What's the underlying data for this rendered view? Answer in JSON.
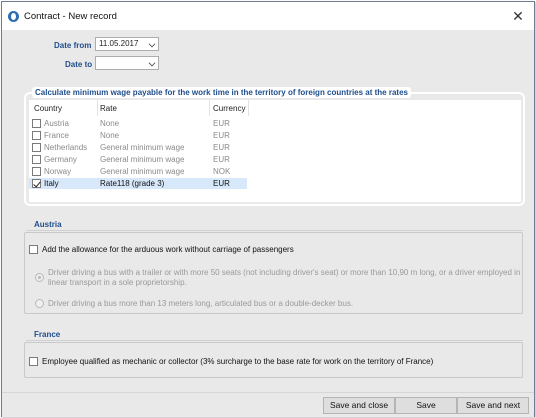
{
  "window": {
    "title": "Contract - New record"
  },
  "form": {
    "date_from_label": "Date from",
    "date_from_value": "11.05.2017",
    "date_to_label": "Date to",
    "date_to_value": ""
  },
  "rates": {
    "legend": "Calculate minimum wage payable for the work time in the territory of foreign countries at the rates",
    "columns": [
      "Country",
      "Rate",
      "Currency"
    ],
    "rows": [
      {
        "country": "Austria",
        "rate": "None",
        "currency": "EUR",
        "checked": false
      },
      {
        "country": "France",
        "rate": "None",
        "currency": "EUR",
        "checked": false
      },
      {
        "country": "Netherlands",
        "rate": "General minimum wage",
        "currency": "EUR",
        "checked": false
      },
      {
        "country": "Germany",
        "rate": "General minimum wage",
        "currency": "EUR",
        "checked": false
      },
      {
        "country": "Norway",
        "rate": "General minimum wage",
        "currency": "NOK",
        "checked": false
      },
      {
        "country": "Italy",
        "rate": "Rate118  (grade 3)",
        "currency": "EUR",
        "checked": true
      }
    ]
  },
  "austria": {
    "title": "Austria",
    "allowance_label": "Add the allowance for the arduous work without carriage of passengers",
    "radio1_line1": "Driver driving a bus with a trailer or with more 50 seats (not including driver's seat) or more than 10,90 m long, or a driver employed in",
    "radio1_line2": "linear transport in a sole proprietorship.",
    "radio2": "Driver driving a bus more than 13 meters long, articulated bus or a double-decker bus."
  },
  "france": {
    "title": "France",
    "mechanic_label": "Employee qualified as mechanic or collector (3% surcharge to the base rate for work on the territory of France)"
  },
  "footer": {
    "save_close": "Save and close",
    "save": "Save",
    "save_next": "Save and next"
  }
}
